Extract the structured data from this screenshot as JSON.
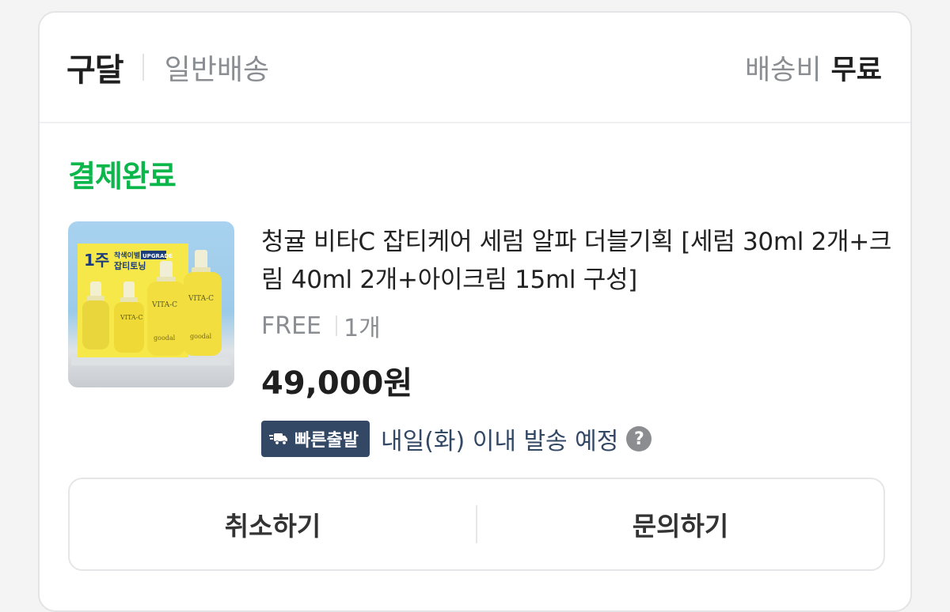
{
  "header": {
    "seller": "구달",
    "shipping_type": "일반배송",
    "shipping_fee_label": "배송비",
    "shipping_fee_value": "무료"
  },
  "order": {
    "status": "결제완료",
    "status_color": "#0bb64a"
  },
  "product": {
    "name": "청귤 비타C 잡티케어 세럼 알파 더블기획 [세럼 30ml 2개+크림 40ml 2개+아이크림 15ml 구성]",
    "option": "FREE",
    "quantity": "1개",
    "price": "49,000원",
    "image": {
      "tag": "1주",
      "line1": "착색이별",
      "upgrade": "UPGRADE",
      "line2": "잡티토닝",
      "brand": "goodal",
      "label": "VITA-C"
    }
  },
  "shipping": {
    "badge_icon": "truck-icon",
    "badge_label": "빠른출발",
    "eta_text": "내일(화) 이내 발송 예정",
    "help_icon": "question-mark-icon",
    "help_glyph": "?",
    "badge_color": "#324865"
  },
  "actions": {
    "cancel_label": "취소하기",
    "inquiry_label": "문의하기"
  }
}
